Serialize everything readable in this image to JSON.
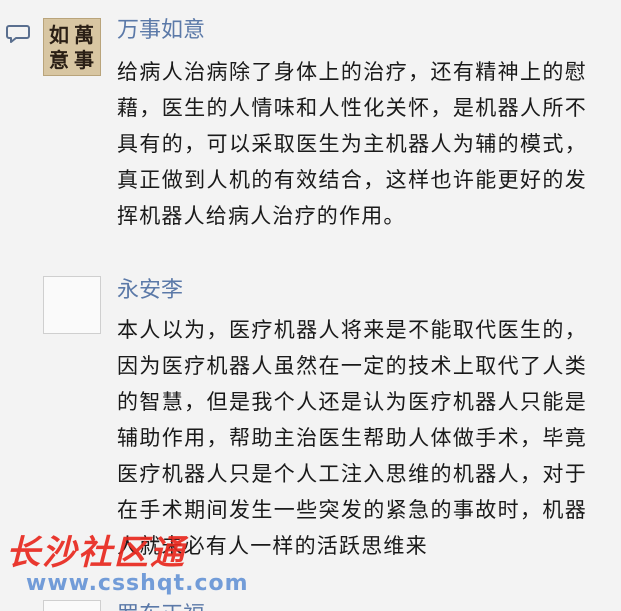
{
  "comments": [
    {
      "username": "万事如意",
      "avatar_text": [
        "如",
        "萬",
        "意",
        "事"
      ],
      "text": "给病人治病除了身体上的治疗，还有精神上的慰藉，医生的人情味和人性化关怀，是机器人所不具有的，可以采取医生为主机器人为辅的模式，真正做到人机的有效结合，这样也许能更好的发挥机器人给病人治疗的作用。"
    },
    {
      "username": "永安李",
      "text": "本人以为，医疗机器人将来是不能取代医生的，因为医疗机器人虽然在一定的技术上取代了人类的智慧，但是我个人还是认为医疗机器人只能是辅助作用，帮助主治医生帮助人体做手术，毕竟医疗机器人只是个人工注入思维的机器人，对于在手术期间发生一些突发的紧急的事故时，机器人就未必有人一样的活跃思维来"
    },
    {
      "username": "罗东正福"
    }
  ],
  "watermark": {
    "title": "长沙社区通",
    "url": "www.csshqt.com"
  },
  "icons": {
    "comment": "comment-bubble-icon"
  },
  "colors": {
    "username": "#5b79a8",
    "text": "#1a1a1a",
    "background": "#f3f3f3"
  }
}
